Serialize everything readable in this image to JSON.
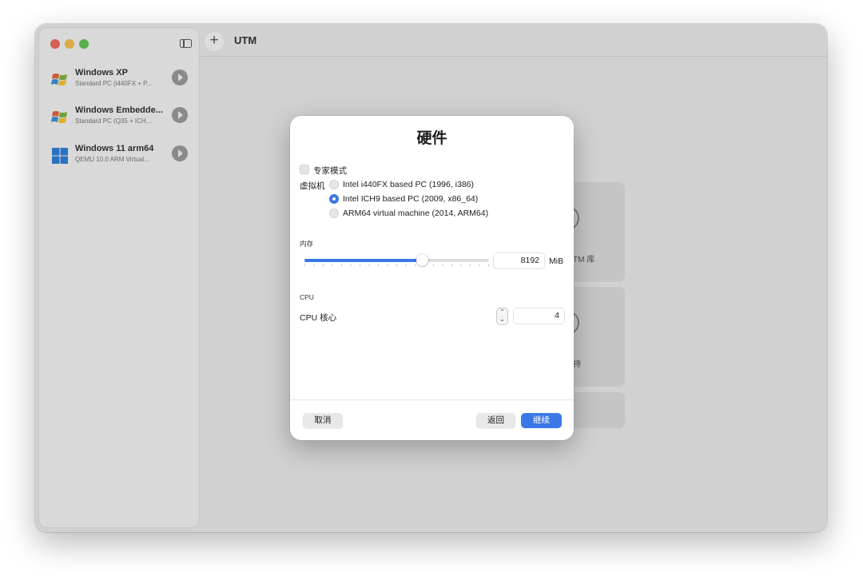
{
  "app": {
    "title": "UTM"
  },
  "sidebar": {
    "items": [
      {
        "name": "Windows XP",
        "desc": "Standard PC (i440FX + P...",
        "icon": "windows-xp-icon"
      },
      {
        "name": "Windows Embedde...",
        "desc": "Standard PC (Q35 + ICH...",
        "icon": "windows-xp-icon"
      },
      {
        "name": "Windows 11 arm64",
        "desc": "QEMU 10.0 ARM Virtual...",
        "icon": "windows-11-icon"
      }
    ]
  },
  "background": {
    "cards": [
      {
        "label": "TM 库"
      },
      {
        "label": "持"
      }
    ]
  },
  "dialog": {
    "title": "硬件",
    "expert_mode_label": "专家模式",
    "vm_label": "虚拟机",
    "machine_options": [
      {
        "label": "Intel i440FX based PC (1996, i386)",
        "selected": false
      },
      {
        "label": "Intel ICH9 based PC (2009, x86_64)",
        "selected": true
      },
      {
        "label": "ARM64 virtual machine (2014, ARM64)",
        "selected": false
      }
    ],
    "memory_section": "内存",
    "memory_value": "8192",
    "memory_unit": "MiB",
    "memory_slider_fraction": 0.64,
    "cpu_section": "CPU",
    "cpu_cores_label": "CPU 核心",
    "cpu_cores_value": "4",
    "cancel_label": "取消",
    "back_label": "返回",
    "continue_label": "继续"
  },
  "colors": {
    "accent": "#3b78e7",
    "traffic_red": "#ec6a5e",
    "traffic_yellow": "#f4bf4f",
    "traffic_green": "#61c554"
  }
}
